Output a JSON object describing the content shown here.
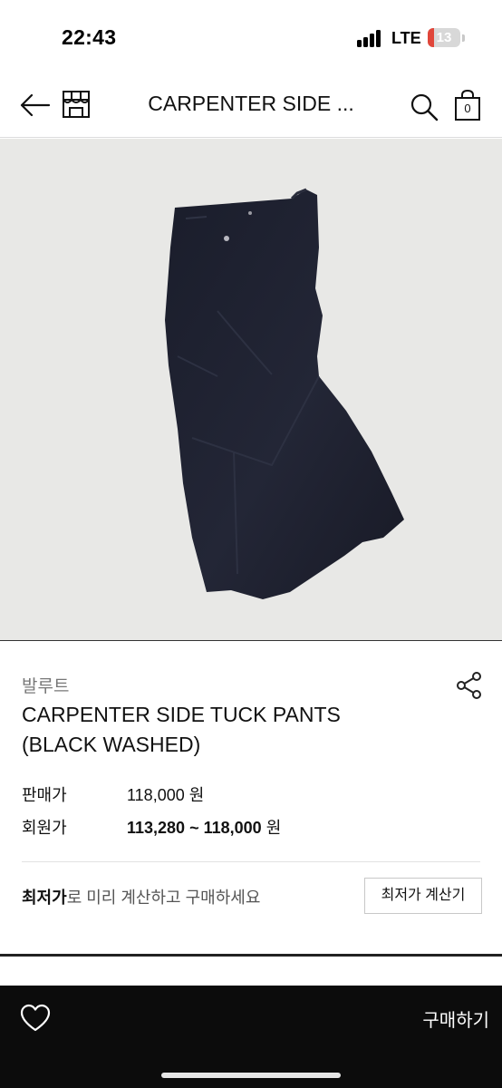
{
  "status_bar": {
    "time": "22:43",
    "network": "LTE",
    "battery_level": "13",
    "battery_color": "#e0463a"
  },
  "nav": {
    "title": "CARPENTER SIDE ...",
    "icons": [
      "back-arrow-icon",
      "store-icon",
      "search-icon",
      "shopping-bag-icon"
    ],
    "cart_count": "0"
  },
  "product": {
    "image_alt": "black washed carpenter side tuck pants photo",
    "brand": "발루트",
    "name_line1": "CARPENTER SIDE TUCK PANTS",
    "name_line2": "(BLACK WASHED)",
    "share_icon": "share-icon"
  },
  "prices": {
    "sale_label": "판매가",
    "sale_value": "118,000",
    "member_label": "회원가",
    "member_value": "113,280 ~ 118,000",
    "currency": "원"
  },
  "lowest": {
    "highlight": "최저가",
    "rest": "로 미리 계산하고 구매하세요",
    "button_label": "최저가 계산기"
  },
  "bottom_bar": {
    "wish_icon": "heart-icon",
    "buy_label": "구매하기"
  },
  "colors": {
    "image_background": "#e8e8e6",
    "pants": "#1e2130",
    "bottom_bar": "#0c0c0c"
  }
}
